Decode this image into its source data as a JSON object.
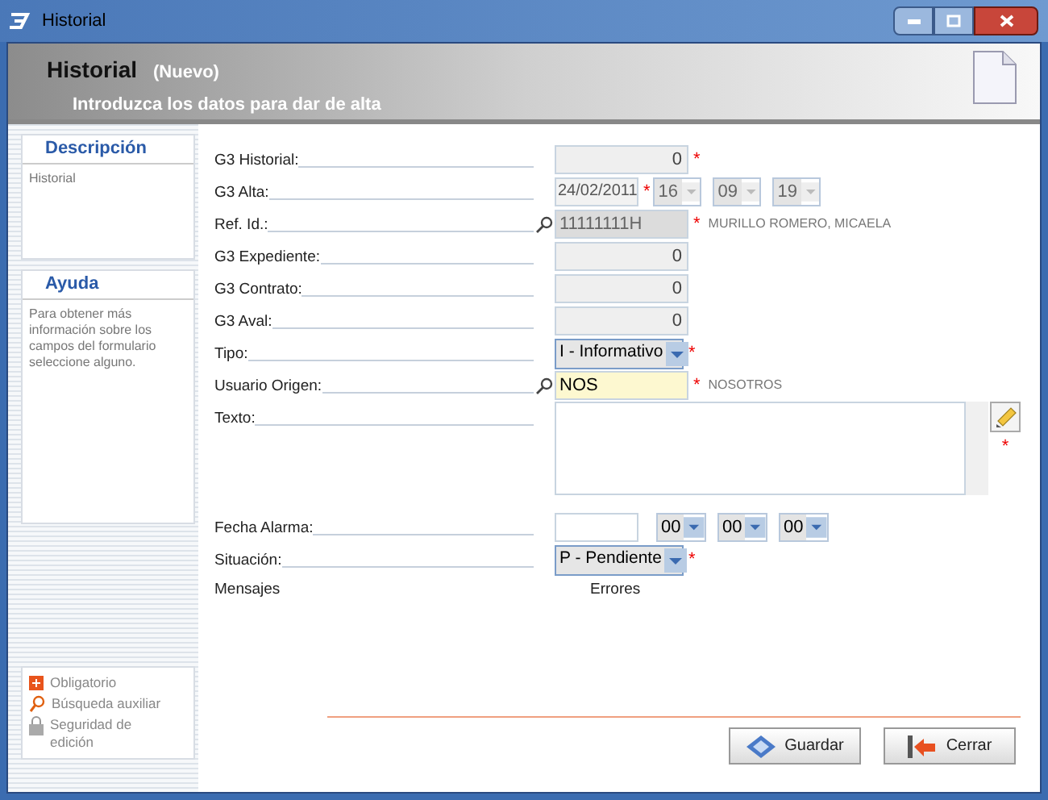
{
  "window": {
    "title": "Historial"
  },
  "header": {
    "title": "Historial",
    "subtitle": "(Nuevo)",
    "description": "Introduzca los datos para dar de alta"
  },
  "sidebar": {
    "panels": [
      {
        "title": "Descripción",
        "text": "Historial"
      },
      {
        "title": "Ayuda",
        "text": "Para obtener más información sobre los campos del formulario seleccione alguno."
      }
    ],
    "legend": [
      {
        "kind": "required",
        "label": "Obligatorio"
      },
      {
        "kind": "search",
        "label": "Búsqueda auxiliar"
      },
      {
        "kind": "lock",
        "label": "Seguridad de edición"
      }
    ]
  },
  "fields": [
    {
      "kind": "number",
      "label": "G3 Historial:",
      "value": "0",
      "required": true
    },
    {
      "kind": "date",
      "label": "G3 Alta:",
      "value": "24/02/2011",
      "required": true,
      "time": [
        "16",
        "09",
        "19"
      ],
      "disabled": true
    },
    {
      "kind": "lookup",
      "label": "Ref. Id.:",
      "value": "11111111H",
      "required": true,
      "note": "MURILLO ROMERO, MICAELA",
      "disabled": true
    },
    {
      "kind": "number",
      "label": "G3 Expediente:",
      "value": "0",
      "required": false
    },
    {
      "kind": "number",
      "label": "G3 Contrato:",
      "value": "0",
      "required": false
    },
    {
      "kind": "number",
      "label": "G3 Aval:",
      "value": "0",
      "required": false
    },
    {
      "kind": "select",
      "label": "Tipo:",
      "value": "I - Informativo",
      "required": true
    },
    {
      "kind": "lookup",
      "label": "Usuario Origen:",
      "value": "NOS",
      "required": true,
      "note": "NOSOTROS",
      "disabled": false
    },
    {
      "kind": "textarea",
      "label": "Texto:",
      "required": true
    },
    {
      "kind": "date",
      "label": "Fecha Alarma:",
      "required": false,
      "time": [
        "00",
        "00",
        "00"
      ],
      "disabled": false
    },
    {
      "kind": "select",
      "label": "Situación:",
      "value": "P - Pendiente",
      "required": true
    }
  ],
  "messages": {
    "label": "Mensajes",
    "value": "Errores"
  },
  "required_mark": "*",
  "buttons": [
    {
      "kind": "save",
      "label": "Guardar"
    },
    {
      "kind": "close",
      "label": "Cerrar"
    }
  ]
}
